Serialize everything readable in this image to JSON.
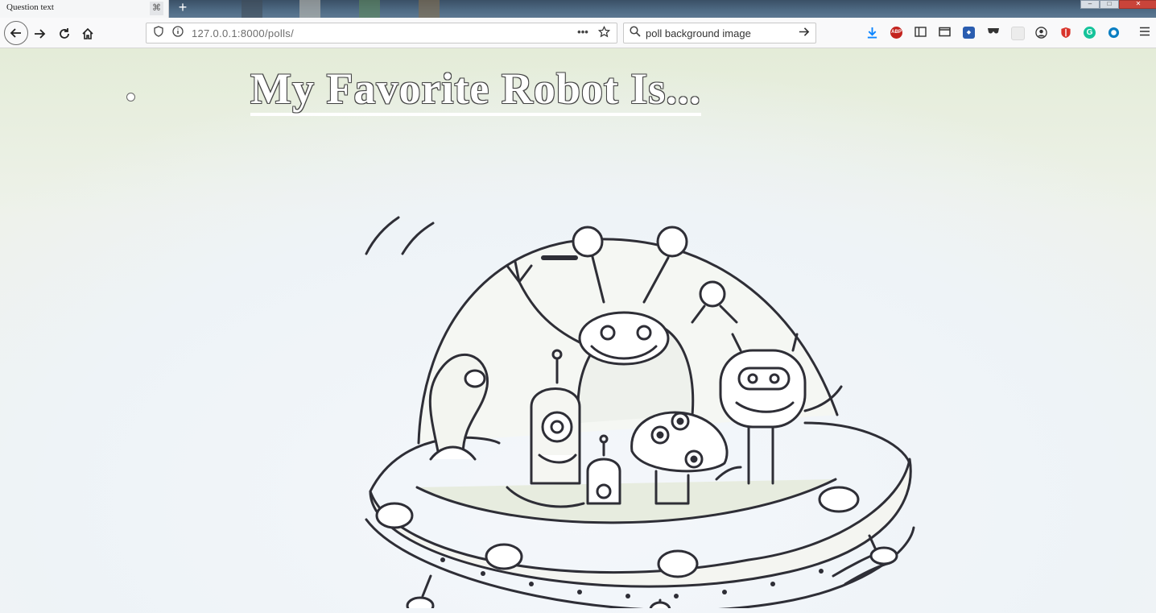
{
  "browser": {
    "tab": {
      "title": "Question text",
      "close_glyph": "⌘"
    },
    "new_tab_label": "+",
    "window_controls": {
      "minimize": "–",
      "maximize": "□",
      "close": "✕"
    },
    "url": "127.0.0.1:8000/polls/",
    "search_text": "poll background image",
    "toolbar_icons": [
      "download-icon",
      "adblock-icon",
      "sidebar-icon",
      "reader-icon",
      "extension-icon",
      "mask-icon",
      "blank-icon",
      "account-icon",
      "shield-icon",
      "grammarly-icon",
      "circle-ext-icon",
      "menu-icon"
    ],
    "adblock_label": "ABP"
  },
  "page": {
    "poll_title": "My Favorite Robot Is...",
    "illustration": "robots-in-flying-saucer"
  },
  "colors": {
    "tabstrip": "#4f6b85",
    "navbar": "#f9f9fa",
    "page_background": "#eef3ea",
    "download_blue": "#0a84ff",
    "adblock_red": "#c3231e",
    "grammarly_green": "#15c39a"
  }
}
